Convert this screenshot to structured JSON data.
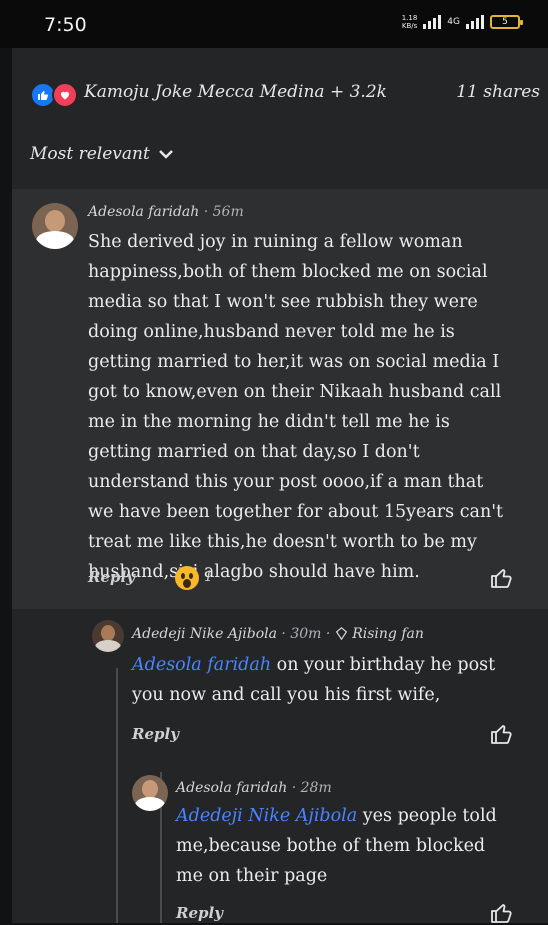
{
  "status": {
    "time": "7:50",
    "net_speed_top": "1.18",
    "net_speed_bottom": "KB/s",
    "lte": "4G",
    "battery": "5"
  },
  "post": {
    "reaction_names": "Kamoju Joke Mecca Medina + 3.2k",
    "shares": "11 shares",
    "sort_label": "Most relevant"
  },
  "comments": [
    {
      "author": "Adesola faridah",
      "time": "· 56m",
      "text": "She derived joy in ruining a fellow woman happiness,both of them blocked me on social media so that I won't see rubbish they were doing online,husband never told me he is getting married to her,it was on social media I got to know,even on their Nikaah husband call me in the morning he didn't tell me he is getting married on that day,so I don't understand this your post oooo,if a man that we have been together for about 15years can't treat me like this,he doesn't worth to be my husband,sisi alagbo should have him.",
      "reply_label": "Reply",
      "reaction_count": "1"
    },
    {
      "author": "Adedeji Nike Ajibola",
      "time": "· 30m ·",
      "badge": "Rising fan",
      "mention": "Adesola faridah",
      "text": " on your birthday he post you now and call you his first wife,",
      "reply_label": "Reply"
    },
    {
      "author": "Adesola faridah",
      "time": "· 28m",
      "mention": "Adedeji Nike Ajibola",
      "text": " yes people told me,because bothe of them blocked me on their page",
      "reply_label": "Reply"
    }
  ]
}
